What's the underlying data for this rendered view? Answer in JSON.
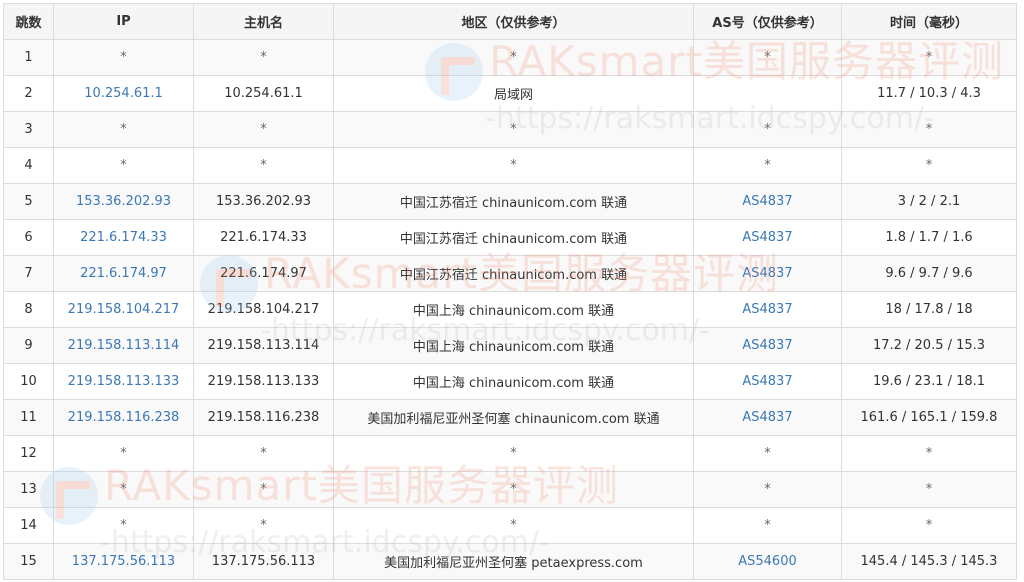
{
  "headers": [
    "跳数",
    "IP",
    "主机名",
    "地区（仅供参考）",
    "AS号（仅供参考）",
    "时间（毫秒）"
  ],
  "rows": [
    {
      "hop": "1",
      "ip": "*",
      "host": "*",
      "region": "*",
      "as": "*",
      "time": "*"
    },
    {
      "hop": "2",
      "ip": "10.254.61.1",
      "host": "10.254.61.1",
      "region": "局域网",
      "as": "",
      "time": "11.7 / 10.3 / 4.3"
    },
    {
      "hop": "3",
      "ip": "*",
      "host": "*",
      "region": "*",
      "as": "*",
      "time": "*"
    },
    {
      "hop": "4",
      "ip": "*",
      "host": "*",
      "region": "*",
      "as": "*",
      "time": "*"
    },
    {
      "hop": "5",
      "ip": "153.36.202.93",
      "host": "153.36.202.93",
      "region": "中国江苏宿迁 chinaunicom.com 联通",
      "as": "AS4837",
      "time": "3 / 2 / 2.1"
    },
    {
      "hop": "6",
      "ip": "221.6.174.33",
      "host": "221.6.174.33",
      "region": "中国江苏宿迁 chinaunicom.com 联通",
      "as": "AS4837",
      "time": "1.8 / 1.7 / 1.6"
    },
    {
      "hop": "7",
      "ip": "221.6.174.97",
      "host": "221.6.174.97",
      "region": "中国江苏宿迁 chinaunicom.com 联通",
      "as": "AS4837",
      "time": "9.6 / 9.7 / 9.6"
    },
    {
      "hop": "8",
      "ip": "219.158.104.217",
      "host": "219.158.104.217",
      "region": "中国上海 chinaunicom.com 联通",
      "as": "AS4837",
      "time": "18 / 17.8 / 18"
    },
    {
      "hop": "9",
      "ip": "219.158.113.114",
      "host": "219.158.113.114",
      "region": "中国上海 chinaunicom.com 联通",
      "as": "AS4837",
      "time": "17.2 / 20.5 / 15.3"
    },
    {
      "hop": "10",
      "ip": "219.158.113.133",
      "host": "219.158.113.133",
      "region": "中国上海 chinaunicom.com 联通",
      "as": "AS4837",
      "time": "19.6 / 23.1 / 18.1"
    },
    {
      "hop": "11",
      "ip": "219.158.116.238",
      "host": "219.158.116.238",
      "region": "美国加利福尼亚州圣何塞 chinaunicom.com 联通",
      "as": "AS4837",
      "time": "161.6 / 165.1 / 159.8"
    },
    {
      "hop": "12",
      "ip": "*",
      "host": "*",
      "region": "*",
      "as": "*",
      "time": "*"
    },
    {
      "hop": "13",
      "ip": "*",
      "host": "*",
      "region": "*",
      "as": "*",
      "time": "*"
    },
    {
      "hop": "14",
      "ip": "*",
      "host": "*",
      "region": "*",
      "as": "*",
      "time": "*"
    },
    {
      "hop": "15",
      "ip": "137.175.56.113",
      "host": "137.175.56.113",
      "region": "美国加利福尼亚州圣何塞 petaexpress.com",
      "as": "AS54600",
      "time": "145.4 / 145.3 / 145.3"
    }
  ],
  "watermark": {
    "brand": "RAKsmart美国服务器评测",
    "url": "-https://raksmart.idcspy.com/-"
  },
  "colors": {
    "link": "#3b78b5",
    "header_bg": "#f5f5f5",
    "stripe": "#f9f9f9",
    "border": "#dcdcdc"
  }
}
